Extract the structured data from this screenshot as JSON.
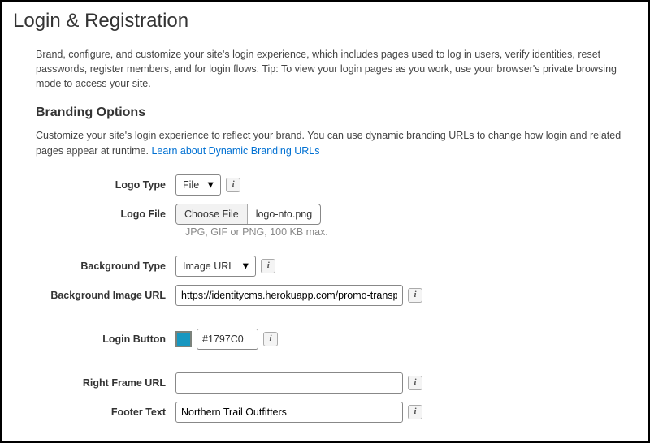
{
  "page": {
    "title": "Login & Registration",
    "intro": "Brand, configure, and customize your site's login experience, which includes pages used to log in users, verify identities, reset passwords, register members, and for login flows. Tip: To view your login pages as you work, use your browser's private browsing mode to access your site."
  },
  "branding": {
    "heading": "Branding Options",
    "desc_prefix": "Customize your site's login experience to reflect your brand. You can use dynamic branding URLs to change how login and related pages appear at runtime. ",
    "link_text": "Learn about Dynamic Branding URLs"
  },
  "fields": {
    "logo_type": {
      "label": "Logo Type",
      "value": "File"
    },
    "logo_file": {
      "label": "Logo File",
      "button": "Choose File",
      "filename": "logo-nto.png",
      "hint": "JPG, GIF or PNG, 100 KB max."
    },
    "background_type": {
      "label": "Background Type",
      "value": "Image URL"
    },
    "background_image_url": {
      "label": "Background Image URL",
      "value": "https://identitycms.herokuapp.com/promo-transp"
    },
    "login_button": {
      "label": "Login Button",
      "color": "#1797C0"
    },
    "right_frame_url": {
      "label": "Right Frame URL",
      "value": ""
    },
    "footer_text": {
      "label": "Footer Text",
      "value": "Northern Trail Outfitters"
    }
  },
  "icons": {
    "info_glyph": "i"
  }
}
